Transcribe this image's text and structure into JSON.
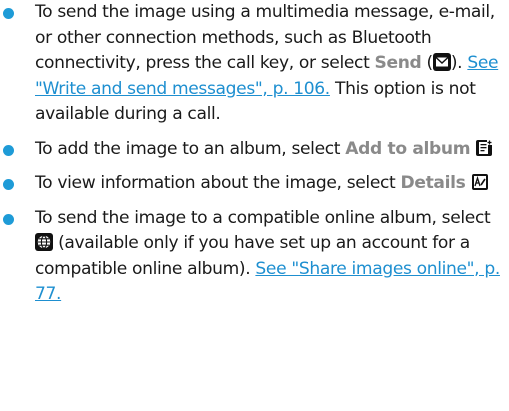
{
  "items": [
    {
      "text_1": "To send the image using a multimedia message, e-mail, or other connection methods, such as Bluetooth connectivity, press the call key, or select ",
      "key": "Send",
      "paren_open": " (",
      "icon": "envelope-icon",
      "paren_close": "). ",
      "link": "See \"Write and send messages\", p. 106.",
      "text_2": " This option is not available during a call."
    },
    {
      "text_1": "To add the image to an album, select ",
      "key": "Add to album",
      "icon": "add-to-album-icon"
    },
    {
      "text_1": "To view information about the image, select ",
      "key": "Details",
      "icon": "details-icon"
    },
    {
      "text_1": "To send the image to a compatible online album, select ",
      "icon": "globe-share-icon",
      "text_2": " (available only if you have set up an account for a compatible online album). ",
      "link": "See \"Share images online\", p. 77."
    }
  ],
  "colors": {
    "bullet": "#1e9bd7",
    "link": "#1e8fd0",
    "key": "#8a8a8a"
  }
}
